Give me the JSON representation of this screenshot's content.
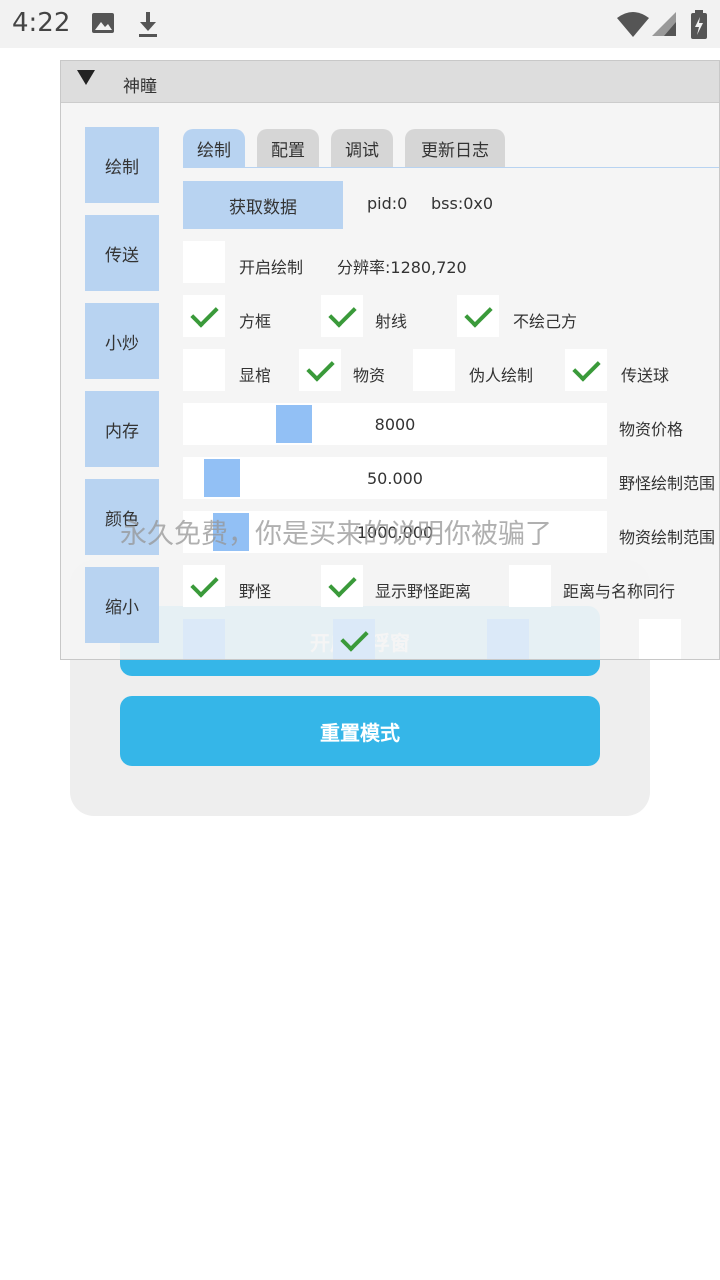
{
  "status_bar": {
    "time": "4:22"
  },
  "background_app": {
    "float_button": "开启悬浮窗",
    "reset_button": "重置模式"
  },
  "menu": {
    "title": "神瞳",
    "side_tabs": [
      "绘制",
      "传送",
      "小炒",
      "内存",
      "颜色",
      "缩小"
    ],
    "tabs": [
      "绘制",
      "配置",
      "调试",
      "更新日志"
    ],
    "fetch_button": "获取数据",
    "pid": "pid:0",
    "bss": "bss:0x0",
    "enable_draw": "开启绘制",
    "resolution": "分辨率:1280,720",
    "row1": {
      "box": "方框",
      "ray": "射线",
      "no_self": "不绘己方"
    },
    "row2": {
      "show_coffin": "显棺",
      "supplies": "物资",
      "fake_draw": "伪人绘制",
      "teleport_ball": "传送球"
    },
    "sliders": [
      {
        "value": "8000",
        "label": "物资价格",
        "fraction": 0.22
      },
      {
        "value": "50.000",
        "label": "野怪绘制范围",
        "fraction": 0.05
      },
      {
        "value": "1000.000",
        "label": "物资绘制范围",
        "fraction": 0.07
      }
    ],
    "row3": {
      "monster": "野怪",
      "show_monster_distance": "显示野怪距离",
      "dist_name_same_line": "距离与名称同行"
    }
  },
  "watermark": "永久免费，你是买来的说明你被骗了",
  "colors": {
    "accent": "#35b6e8",
    "tab_blue": "#b8d3f1",
    "check_green": "#3a9a3a",
    "slider_thumb": "#92c0f5"
  }
}
